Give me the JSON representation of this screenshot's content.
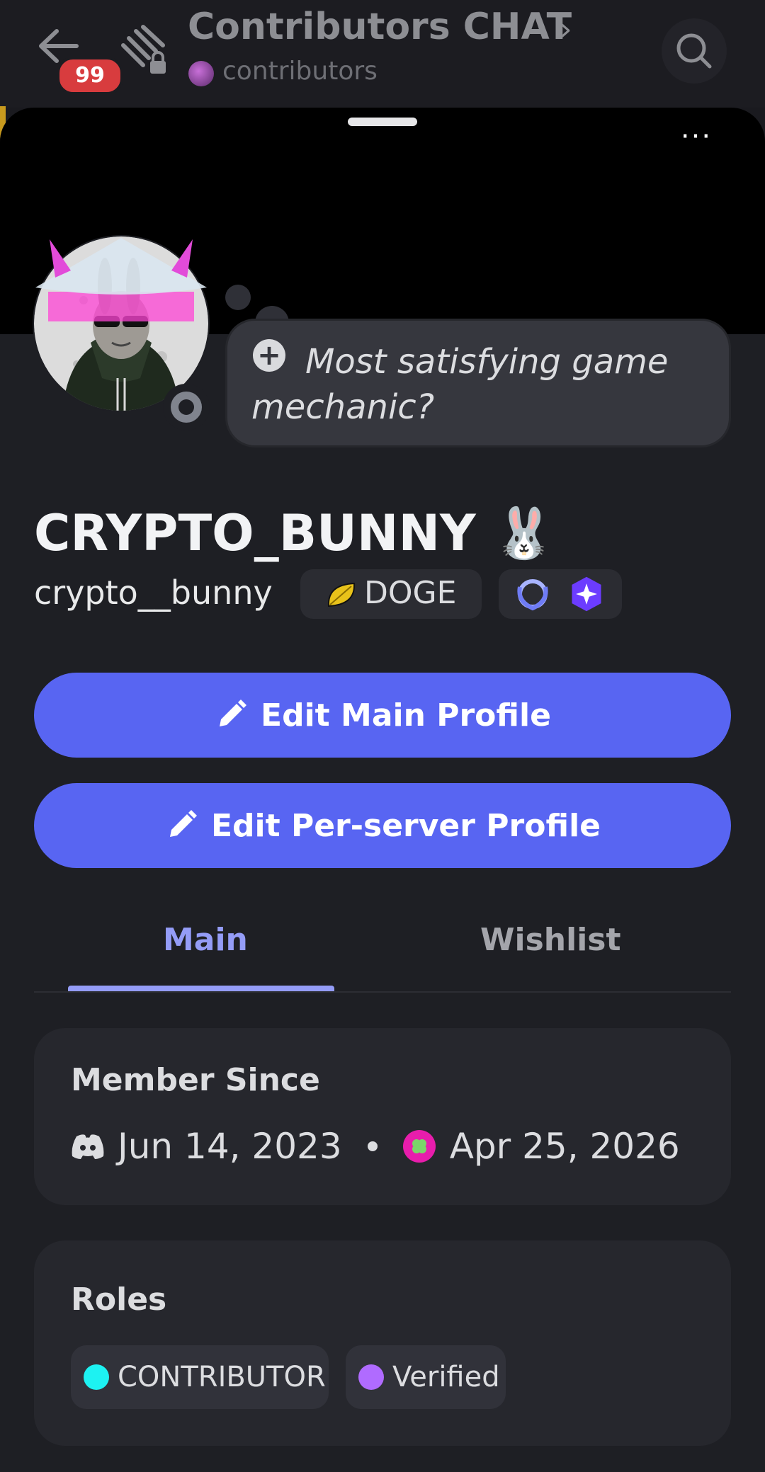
{
  "header": {
    "back_label": "back",
    "unread_badge": "99",
    "channel_title": "Contributors CHAT",
    "server_name": "contributors"
  },
  "profile": {
    "custom_status": "Most satisfying game mechanic?",
    "display_name": "CRYPTO_BUNNY",
    "display_emoji": "🐰",
    "username": "crypto__bunny",
    "guild_tag": "DOGE"
  },
  "actions": {
    "edit_main": "Edit Main Profile",
    "edit_server": "Edit Per-server Profile"
  },
  "tabs": [
    {
      "label": "Main",
      "active": true
    },
    {
      "label": "Wishlist",
      "active": false
    }
  ],
  "member_since": {
    "title": "Member Since",
    "discord_date": "Jun 14, 2023",
    "server_date": "Apr 25, 2026"
  },
  "roles": {
    "title": "Roles",
    "items": [
      {
        "label": "CONTRIBUTOR",
        "color": "#1df2f2"
      },
      {
        "label": "Verified",
        "color": "#b06bff"
      }
    ]
  },
  "colors": {
    "accent": "#5865f2",
    "tab_active": "#949cf7",
    "status_offline": "#80848e"
  }
}
